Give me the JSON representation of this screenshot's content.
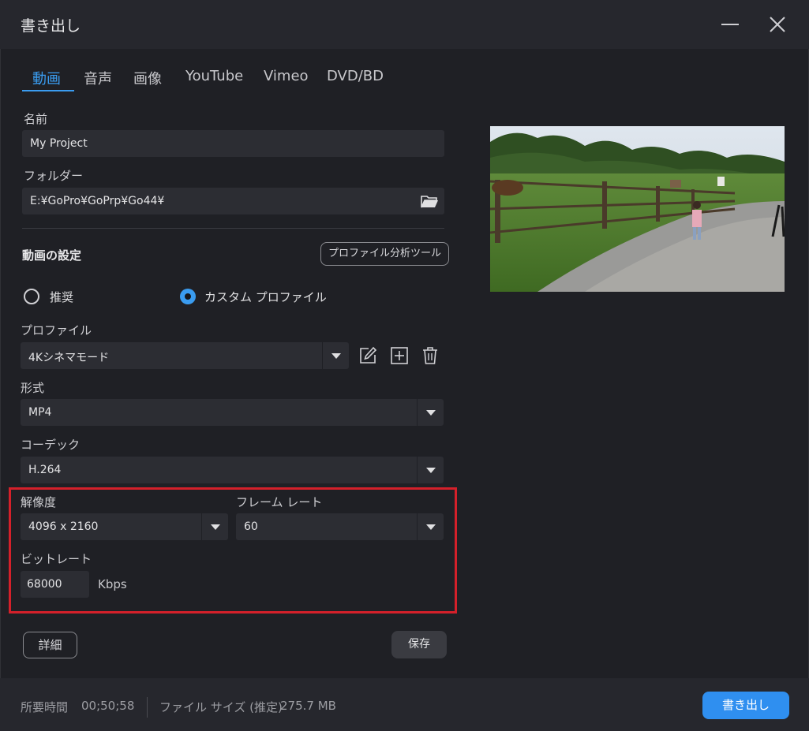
{
  "window": {
    "title": "書き出し"
  },
  "tabs": [
    {
      "label": "動画"
    },
    {
      "label": "音声"
    },
    {
      "label": "画像"
    },
    {
      "label": "YouTube"
    },
    {
      "label": "Vimeo"
    },
    {
      "label": "DVD/BD"
    }
  ],
  "name": {
    "label": "名前",
    "value": "My Project"
  },
  "folder": {
    "label": "フォルダー",
    "value": "E:¥GoPro¥GoPrp¥Go44¥",
    "icon": "folder-open-icon"
  },
  "video_settings": {
    "title": "動画の設定",
    "profile_tool_button": "プロファイル分析ツール",
    "radio_recommended": "推奨",
    "radio_custom": "カスタム プロファイル",
    "selected": "custom"
  },
  "profile": {
    "label": "プロファイル",
    "value": "4Kシネマモード",
    "icons": [
      "edit-icon",
      "add-icon",
      "trash-icon"
    ]
  },
  "format": {
    "label": "形式",
    "value": "MP4"
  },
  "codec": {
    "label": "コーデック",
    "value": "H.264"
  },
  "resolution": {
    "label": "解像度",
    "value": "4096 x 2160"
  },
  "framerate": {
    "label": "フレーム レート",
    "value": "60"
  },
  "bitrate": {
    "label": "ビットレート",
    "value": "68000",
    "unit": "Kbps"
  },
  "buttons": {
    "details": "詳細",
    "save": "保存",
    "export": "書き出し"
  },
  "footer": {
    "duration_label": "所要時間",
    "duration_value": "00;50;58",
    "filesize_label": "ファイル サイズ (推定)",
    "filesize_value": "275.7 MB"
  },
  "colors": {
    "accent": "#3a9cf0",
    "highlight_border": "#d4202a",
    "background": "#1f2025"
  }
}
